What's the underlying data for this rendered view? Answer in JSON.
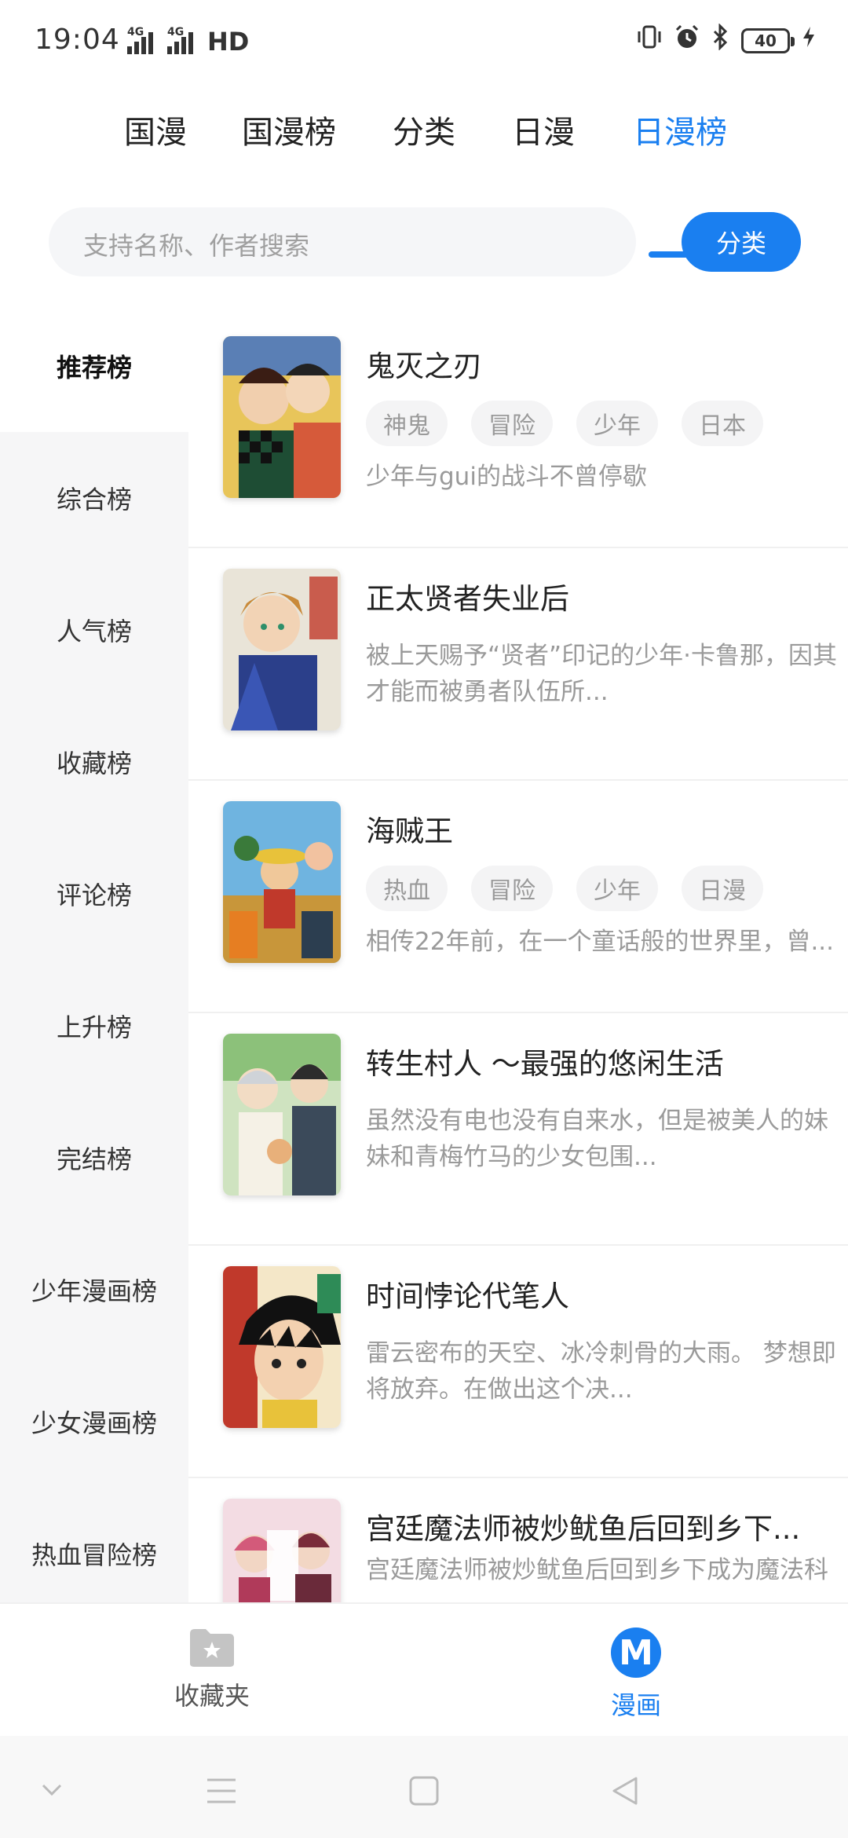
{
  "status": {
    "time": "19:04",
    "net1": "4G",
    "net2": "4G",
    "hd": "HD",
    "battery": "40"
  },
  "tabs": [
    {
      "label": "国漫"
    },
    {
      "label": "国漫榜"
    },
    {
      "label": "分类"
    },
    {
      "label": "日漫"
    },
    {
      "label": "日漫榜"
    }
  ],
  "search": {
    "placeholder": "支持名称、作者搜索",
    "button": "分类"
  },
  "sidebar": {
    "items": [
      {
        "label": "推荐榜"
      },
      {
        "label": "综合榜"
      },
      {
        "label": "人气榜"
      },
      {
        "label": "收藏榜"
      },
      {
        "label": "评论榜"
      },
      {
        "label": "上升榜"
      },
      {
        "label": "完结榜"
      },
      {
        "label": "少年漫画榜"
      },
      {
        "label": "少女漫画榜"
      },
      {
        "label": "热血冒险榜"
      }
    ]
  },
  "list": [
    {
      "title": "鬼灭之刃",
      "tags": [
        "神鬼",
        "冒险",
        "少年",
        "日本"
      ],
      "desc": "少年与gui的战斗不曾停歇"
    },
    {
      "title": "正太贤者失业后",
      "tags": [],
      "desc": "被上天赐予“贤者”印记的少年·卡鲁那，因其才能而被勇者队伍所..."
    },
    {
      "title": "海贼王",
      "tags": [
        "热血",
        "冒险",
        "少年",
        "日漫"
      ],
      "desc": "相传22年前，在一个童话般的世界里，曾..."
    },
    {
      "title": "转生村人 ～最强的悠闲生活",
      "tags": [],
      "desc": "虽然没有电也没有自来水，但是被美人的妹妹和青梅竹马的少女包围..."
    },
    {
      "title": "时间悖论代笔人",
      "tags": [],
      "desc": "雷云密布的天空、冰冷刺骨的大雨。 梦想即将放弃。在做出这个决..."
    },
    {
      "title": "宫廷魔法师被炒鱿鱼后回到乡下...",
      "tags": [],
      "desc": "宫廷魔法师被炒鱿鱼后回到乡下成为魔法科"
    }
  ],
  "bottom_nav": {
    "favorites": "收藏夹",
    "manga": "漫画",
    "manga_letter": "M"
  },
  "colors": {
    "accent": "#1a7ff0"
  }
}
